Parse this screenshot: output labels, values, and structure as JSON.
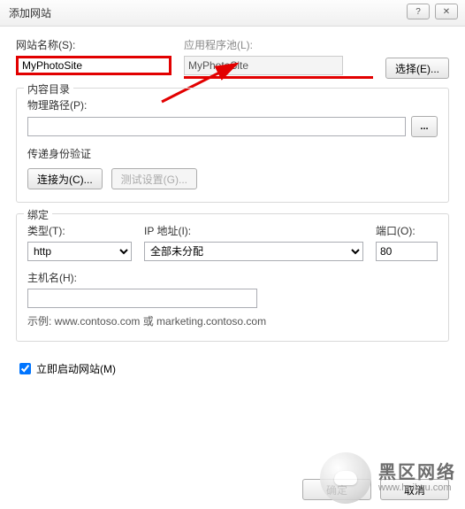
{
  "window": {
    "title": "添加网站",
    "help_icon": "?",
    "close_icon": "✕"
  },
  "site": {
    "name_label": "网站名称(S):",
    "name_value": "MyPhotoSite",
    "pool_label": "应用程序池(L):",
    "pool_value": "MyPhotoSite",
    "select_btn": "选择(E)..."
  },
  "content_dir": {
    "group_title": "内容目录",
    "path_label": "物理路径(P):",
    "path_value": "",
    "browse": "...",
    "auth_label": "传递身份验证",
    "connect_as": "连接为(C)...",
    "test": "测试设置(G)..."
  },
  "binding": {
    "group_title": "绑定",
    "type_label": "类型(T):",
    "type_value": "http",
    "ip_label": "IP 地址(I):",
    "ip_value": "全部未分配",
    "port_label": "端口(O):",
    "port_value": "80",
    "host_label": "主机名(H):",
    "host_value": "",
    "example": "示例: www.contoso.com 或 marketing.contoso.com"
  },
  "start_now": {
    "label": "立即启动网站(M)",
    "checked": true
  },
  "footer": {
    "ok": "确定",
    "cancel": "取消"
  },
  "watermark": {
    "brand": "黑区网络",
    "url": "www.heikqu.com"
  }
}
